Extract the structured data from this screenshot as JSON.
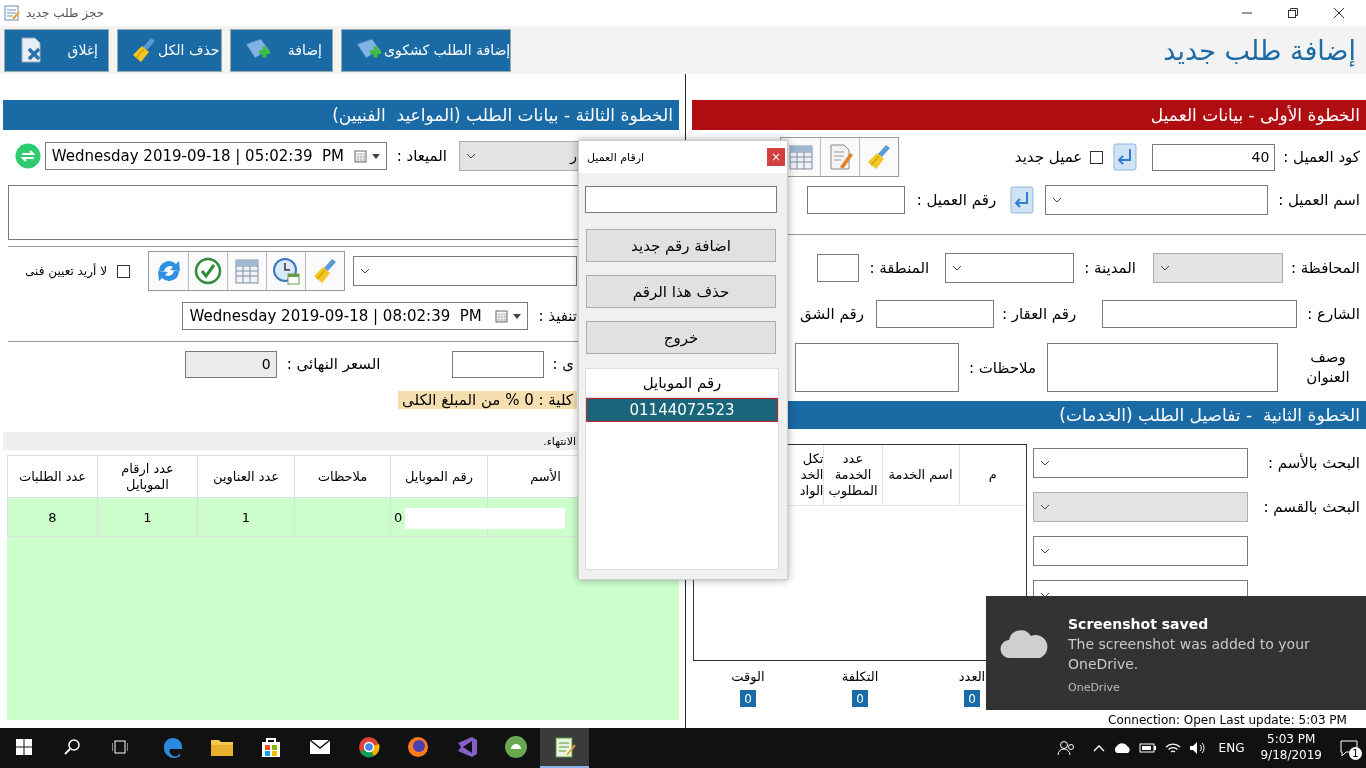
{
  "window": {
    "title": "حجز طلب جديد"
  },
  "toolbar": {
    "heading": "إضافة طلب جديد",
    "buttons": [
      {
        "label": "إضافة الطلب كشكوى",
        "kind": "complaint"
      },
      {
        "label": "إضافة",
        "kind": "add"
      },
      {
        "label": "حذف الكل",
        "kind": "clear"
      },
      {
        "label": "إغلاق",
        "kind": "close"
      }
    ]
  },
  "order": {
    "header": "الخطوة الثالثة - بيانات الطلب (المواعيد  الفنيين)",
    "technician": {
      "value": "ر",
      "disabled": true
    },
    "appointment": {
      "label": "الميعاد :",
      "value": "Wednesday 2019-09-18 | 05:02:39  PM"
    },
    "no_technician": {
      "label": "لا أريد تعيين فنى",
      "checked": false
    },
    "execution": {
      "label": "تنفيذ :",
      "value": "Wednesday 2019-09-18 | 08:02:39  PM"
    },
    "discount_label": "ى :",
    "final_price": {
      "label": "السعر النهائى :",
      "value": "0"
    },
    "percent_note": "كلية : 0 % من المبلغ الكلى",
    "hint": "الانتهاء.",
    "table": {
      "columns": [
        "الأسم",
        "رقم الموبايل",
        "ملاحظات",
        "عدد العناوين",
        "عدد ارقام الموبايل",
        "عدد الطلبات"
      ],
      "rows": [
        {
          "mobile": "0",
          "addresses": "1",
          "mobile_count": "1",
          "orders": "8"
        }
      ]
    }
  },
  "customer": {
    "header": "الخطوة الأولى - بيانات العميل",
    "code": {
      "label": "كود العميل :",
      "value": "40"
    },
    "new_customer": {
      "label": "عميل جديد",
      "checked": false
    },
    "name": {
      "label": "اسم العميل :",
      "disabled": false
    },
    "number": {
      "label": "رقم العميل :"
    },
    "governorate": {
      "label": "المحافظة :",
      "disabled": true
    },
    "city": {
      "label": "المدينة :",
      "disabled": false
    },
    "area": {
      "label": "المنطقة :"
    },
    "street": {
      "label": "الشارع :"
    },
    "building": {
      "label": "رقم العقار :"
    },
    "apartment": {
      "label": "رقم الشق"
    },
    "address": {
      "label": "وصف العنوان"
    },
    "notes": {
      "label": "ملاحظات :"
    }
  },
  "services": {
    "header": "الخطوة الثانية  - تفاصيل الطلب (الخدمات)",
    "filters": [
      {
        "label": "البحث بالأسم :",
        "disabled": false
      },
      {
        "label": "البحث بالقسم :",
        "disabled": true
      },
      {
        "disabled": false
      },
      {
        "disabled": false
      }
    ],
    "columns": [
      "م",
      "اسم الخدمة",
      "عدد الخدمة المطلوب",
      "تكل الخد الواد"
    ],
    "totals": [
      {
        "label": "العدد",
        "value": "0"
      },
      {
        "label": "التكلفة",
        "value": "0"
      },
      {
        "label": "الوقت",
        "value": "0"
      }
    ]
  },
  "status_bar": "Connection: Open Last update: 5:03 PM",
  "dialog": {
    "title": "ارقام العميل",
    "close": "×",
    "buttons": [
      "اضافة رقم جديد",
      "حذف هذا الرقم",
      "خروج"
    ],
    "list_header": "رقم الموبايل",
    "numbers": [
      {
        "value": "01144072523",
        "selected": true
      }
    ]
  },
  "toast": {
    "title": "Screenshot saved",
    "message": "The screenshot was added to your OneDrive.",
    "source": "OneDrive"
  },
  "taskbar": {
    "apps": [
      {
        "kind": "edge",
        "selected": false
      },
      {
        "kind": "folder",
        "selected": false
      },
      {
        "kind": "store",
        "selected": false
      },
      {
        "kind": "mail",
        "selected": false
      },
      {
        "kind": "chrome",
        "selected": false
      },
      {
        "kind": "firefox",
        "selected": false
      },
      {
        "kind": "studio",
        "selected": false
      },
      {
        "kind": "android",
        "selected": false
      },
      {
        "kind": "form",
        "selected": true
      }
    ],
    "language": "ENG",
    "time": "5:03 PM",
    "date": "9/18/2019",
    "notifications": "1"
  }
}
